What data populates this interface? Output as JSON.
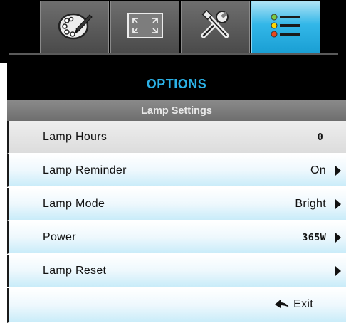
{
  "tabs": [
    {
      "icon": "palette-icon",
      "active": false
    },
    {
      "icon": "screen-fit-icon",
      "active": false
    },
    {
      "icon": "tools-icon",
      "active": false
    },
    {
      "icon": "options-list-icon",
      "active": true
    }
  ],
  "header": {
    "title": "OPTIONS",
    "title_color": "#2bb1e6"
  },
  "section": {
    "title": "Lamp Settings"
  },
  "rows": [
    {
      "label": "Lamp Hours",
      "value": "0",
      "has_arrow": false,
      "selected": true
    },
    {
      "label": "Lamp Reminder",
      "value": "On",
      "has_arrow": true,
      "selected": false
    },
    {
      "label": "Lamp Mode",
      "value": "Bright",
      "has_arrow": true,
      "selected": false
    },
    {
      "label": "Power",
      "value": "365W",
      "has_arrow": true,
      "selected": false
    },
    {
      "label": "Lamp Reset",
      "value": "",
      "has_arrow": true,
      "selected": false
    }
  ],
  "exit": {
    "label": "Exit",
    "icon": "return-arrow-icon"
  }
}
